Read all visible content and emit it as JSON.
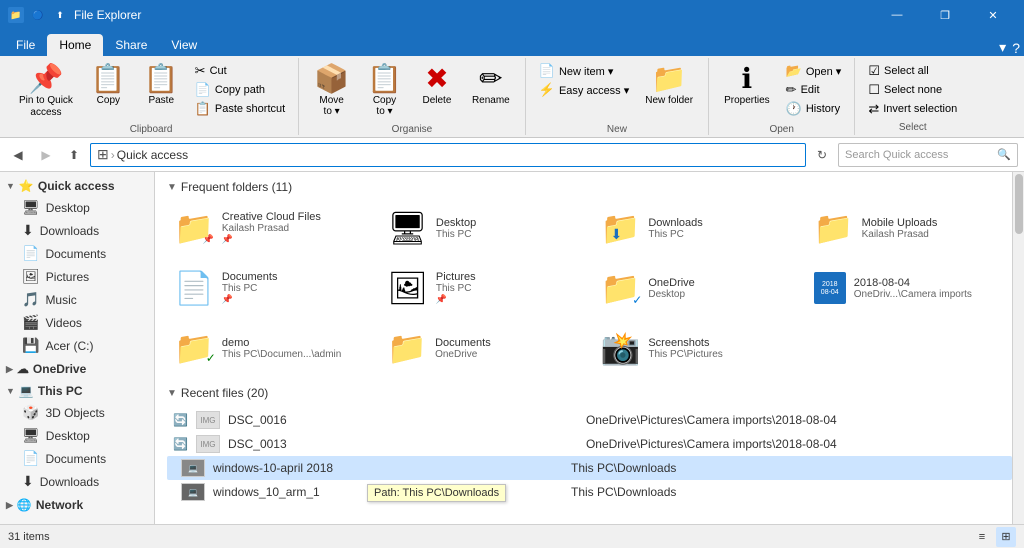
{
  "titleBar": {
    "title": "File Explorer",
    "icons": [
      "📁"
    ],
    "controls": [
      "—",
      "❐",
      "✕"
    ]
  },
  "ribbon": {
    "tabs": [
      "File",
      "Home",
      "Share",
      "View"
    ],
    "activeTab": "Home",
    "groups": {
      "clipboard": {
        "label": "Clipboard",
        "buttons": [
          {
            "id": "pin-quick-access",
            "label": "Pin to Quick\naccess",
            "icon": "📌",
            "type": "large"
          },
          {
            "id": "copy",
            "label": "Copy",
            "icon": "📋",
            "type": "large"
          },
          {
            "id": "paste",
            "label": "Paste",
            "icon": "📋",
            "type": "large"
          },
          {
            "id": "cut",
            "label": "Cut",
            "icon": "✂",
            "type": "small"
          },
          {
            "id": "copy-path",
            "label": "Copy path",
            "icon": "📄",
            "type": "small"
          },
          {
            "id": "paste-shortcut",
            "label": "Paste shortcut",
            "icon": "📋",
            "type": "small"
          }
        ]
      },
      "organise": {
        "label": "Organise",
        "buttons": [
          {
            "id": "move-to",
            "label": "Move to ▾",
            "icon": "📦",
            "type": "large"
          },
          {
            "id": "copy-to",
            "label": "Copy to ▾",
            "icon": "📋",
            "type": "large"
          },
          {
            "id": "delete",
            "label": "Delete",
            "icon": "🗑",
            "type": "large"
          },
          {
            "id": "rename",
            "label": "Rename",
            "icon": "✏",
            "type": "large"
          }
        ]
      },
      "new": {
        "label": "New",
        "buttons": [
          {
            "id": "new-item",
            "label": "New item ▾",
            "icon": "📄",
            "type": "small"
          },
          {
            "id": "easy-access",
            "label": "Easy access ▾",
            "icon": "⚡",
            "type": "small"
          },
          {
            "id": "new-folder",
            "label": "New folder",
            "icon": "📁",
            "type": "large"
          }
        ]
      },
      "open": {
        "label": "Open",
        "buttons": [
          {
            "id": "properties",
            "label": "Properties",
            "icon": "ℹ",
            "type": "large"
          },
          {
            "id": "open",
            "label": "Open ▾",
            "icon": "📂",
            "type": "small"
          },
          {
            "id": "edit",
            "label": "Edit",
            "icon": "✏",
            "type": "small"
          },
          {
            "id": "history",
            "label": "History",
            "icon": "🕐",
            "type": "small"
          }
        ]
      },
      "select": {
        "label": "Select",
        "buttons": [
          {
            "id": "select-all",
            "label": "Select all",
            "icon": "☑",
            "type": "small"
          },
          {
            "id": "select-none",
            "label": "Select none",
            "icon": "☐",
            "type": "small"
          },
          {
            "id": "invert-selection",
            "label": "Invert selection",
            "icon": "⇄",
            "type": "small"
          }
        ]
      }
    }
  },
  "addressBar": {
    "backDisabled": false,
    "forwardDisabled": true,
    "upDisabled": false,
    "path": "Quick access",
    "searchPlaceholder": "Search Quick access",
    "refreshLabel": "↻"
  },
  "sidebar": {
    "sections": [
      {
        "id": "quick-access",
        "label": "Quick access",
        "icon": "⭐",
        "expanded": true,
        "items": [
          {
            "id": "desktop",
            "label": "Desktop",
            "icon": "🖥"
          },
          {
            "id": "downloads",
            "label": "Downloads",
            "icon": "⬇",
            "active": true
          },
          {
            "id": "documents",
            "label": "Documents",
            "icon": "📄"
          },
          {
            "id": "pictures",
            "label": "Pictures",
            "icon": "🖼"
          },
          {
            "id": "music",
            "label": "Music",
            "icon": "🎵"
          },
          {
            "id": "videos",
            "label": "Videos",
            "icon": "🎬"
          },
          {
            "id": "acer",
            "label": "Acer (C:)",
            "icon": "💾"
          }
        ]
      },
      {
        "id": "onedrive",
        "label": "OneDrive",
        "icon": "☁",
        "expanded": false,
        "items": []
      },
      {
        "id": "this-pc",
        "label": "This PC",
        "icon": "💻",
        "expanded": true,
        "items": [
          {
            "id": "3d-objects",
            "label": "3D Objects",
            "icon": "🎲"
          },
          {
            "id": "desktop2",
            "label": "Desktop",
            "icon": "🖥"
          },
          {
            "id": "documents2",
            "label": "Documents",
            "icon": "📄"
          },
          {
            "id": "downloads2",
            "label": "Downloads",
            "icon": "⬇"
          }
        ]
      },
      {
        "id": "network",
        "label": "Network",
        "icon": "🌐",
        "expanded": false,
        "items": []
      }
    ]
  },
  "frequentFolders": {
    "header": "Frequent folders (11)",
    "items": [
      {
        "id": "creative-cloud",
        "name": "Creative Cloud Files",
        "path": "Kailash Prasad",
        "icon": "📁",
        "pinned": true,
        "hasPin": true
      },
      {
        "id": "desktop-folder",
        "name": "Desktop",
        "path": "This PC",
        "icon": "🖥",
        "pinned": false
      },
      {
        "id": "downloads-folder",
        "name": "Downloads",
        "path": "This PC",
        "icon": "📁",
        "hasDownload": true,
        "pinned": false
      },
      {
        "id": "mobile-uploads",
        "name": "Mobile Uploads",
        "path": "Kailash Prasad",
        "icon": "📁",
        "pinned": false
      },
      {
        "id": "documents-folder",
        "name": "Documents",
        "path": "This PC",
        "icon": "📄",
        "pinned": true
      },
      {
        "id": "pictures-folder",
        "name": "Pictures",
        "path": "This PC",
        "icon": "🖼",
        "pinned": true
      },
      {
        "id": "onedrive-folder",
        "name": "OneDrive",
        "path": "Desktop",
        "icon": "📁",
        "hasCloud": true,
        "pinned": false
      },
      {
        "id": "date-folder",
        "name": "2018-08-04",
        "path": "OneDriv...\\Camera imports",
        "icon": "date",
        "pinned": false
      },
      {
        "id": "demo-folder",
        "name": "demo",
        "path": "This PC\\Documen...\\admin",
        "icon": "📁",
        "hasCheck": true,
        "pinned": false
      },
      {
        "id": "documents-onedrive",
        "name": "Documents",
        "path": "OneDrive",
        "icon": "📁",
        "hasCloud2": true,
        "pinned": false
      },
      {
        "id": "screenshots",
        "name": "Screenshots",
        "path": "This PC\\Pictures",
        "icon": "📸",
        "pinned": false
      }
    ]
  },
  "recentFiles": {
    "header": "Recent files (20)",
    "items": [
      {
        "id": "dsc0016",
        "name": "DSC_0016",
        "location": "OneDrive\\Pictures\\Camera imports\\2018-08-04",
        "synced": true
      },
      {
        "id": "dsc0013",
        "name": "DSC_0013",
        "location": "OneDrive\\Pictures\\Camera imports\\2018-08-04",
        "synced": true
      },
      {
        "id": "windows10april",
        "name": "windows-10-april 2018",
        "location": "This PC\\Downloads",
        "selected": true,
        "tooltip": "Path: This PC\\Downloads"
      },
      {
        "id": "windows10arm",
        "name": "windows_10_arm_1",
        "location": "This PC\\Downloads",
        "selected": false
      }
    ]
  },
  "statusBar": {
    "itemCount": "31 items",
    "viewButtons": [
      "≡",
      "⊞"
    ]
  }
}
